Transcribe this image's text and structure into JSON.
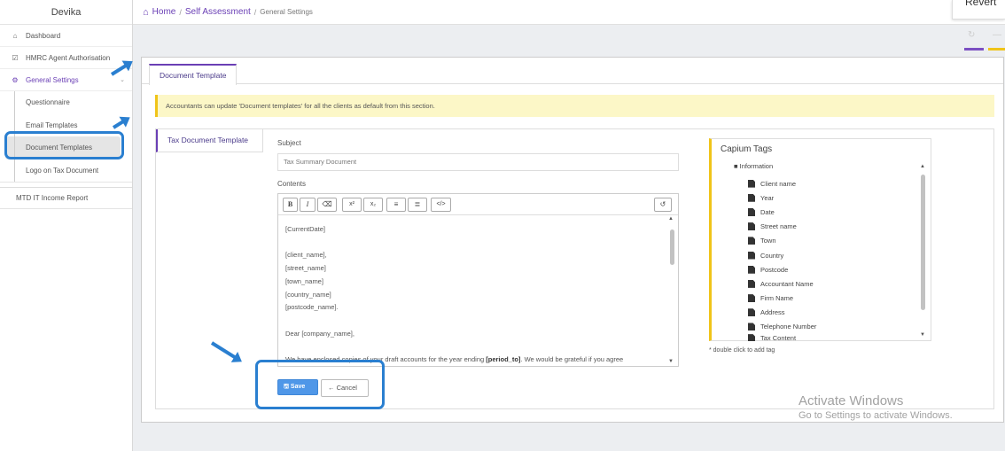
{
  "sidebar": {
    "brand": "Devika",
    "items": [
      {
        "label": "Dashboard",
        "icon": "home-icon"
      },
      {
        "label": "HMRC Agent Authorisation",
        "icon": "checkbox-icon"
      },
      {
        "label": "General Settings",
        "icon": "cogs-icon"
      }
    ],
    "sub_items": [
      {
        "label": "Questionnaire"
      },
      {
        "label": "Email Templates"
      },
      {
        "label": "Document Templates"
      },
      {
        "label": "Logo on Tax Document"
      }
    ],
    "mtd_item": "MTD IT Income Report"
  },
  "breadcrumb": {
    "home": "Home",
    "section": "Self Assessment",
    "current": "General Settings"
  },
  "revert_label": "Revert",
  "main": {
    "tab_label": "Document Template",
    "notice": "Accountants can update 'Document templates' for all the clients as default from this section.",
    "vertical_tab": "Tax Document Template",
    "subject_label": "Subject",
    "subject_value": "Tax Summary Document",
    "contents_label": "Contents",
    "editor_toolbar": {
      "bold": "B",
      "italic": "I",
      "superscript": "x²",
      "subscript": "x₂",
      "code": "</>"
    },
    "editor_lines": {
      "l1": "[CurrentDate]",
      "l2": "[client_name],",
      "l3": "[street_name]",
      "l4": "[town_name]",
      "l5": "[country_name]",
      "l6": "[postcode_name].",
      "l7": "Dear [company_name],",
      "l8a": "We have enclosed copies of your draft accounts for the year ending ",
      "l8b": "[period_to]",
      "l8c": ". We would be grateful if you agree"
    },
    "save_label": "Save",
    "cancel_label": "Cancel"
  },
  "tags": {
    "title": "Capium Tags",
    "folder": "Information",
    "items": [
      "Client name",
      "Year",
      "Date",
      "Street name",
      "Town",
      "Country",
      "Postcode",
      "Accountant Name",
      "Firm Name",
      "Address",
      "Telephone Number",
      "Tax Content"
    ],
    "hint": "* double click to add tag"
  },
  "windows_watermark": {
    "line1": "Activate Windows",
    "line2": "Go to Settings to activate Windows."
  },
  "colors": {
    "accent": "#6a3fb5",
    "notice_bg": "#fcf7c7",
    "notice_border": "#f0c419",
    "save_button": "#4f97e8",
    "annotation": "#2a7fd0"
  }
}
